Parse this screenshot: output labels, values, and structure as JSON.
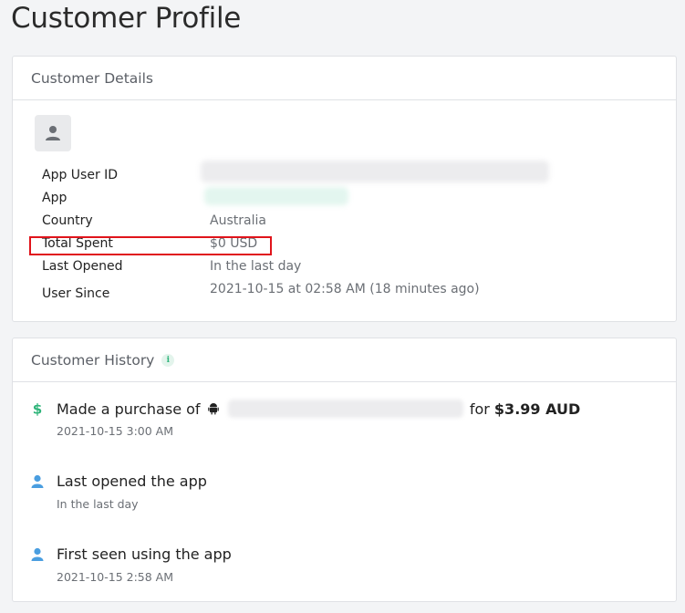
{
  "page": {
    "title": "Customer Profile"
  },
  "details": {
    "header": "Customer Details",
    "rows": [
      {
        "label": "App User ID",
        "value": ""
      },
      {
        "label": "App",
        "value": ""
      },
      {
        "label": "Country",
        "value": "Australia"
      },
      {
        "label": "Total Spent",
        "value": "$0 USD"
      },
      {
        "label": "Last Opened",
        "value": "In the last day"
      },
      {
        "label": "User Since",
        "value": "2021-10-15 at 02:58 AM (18 minutes ago)"
      }
    ]
  },
  "history": {
    "header": "Customer History",
    "info_icon": "i",
    "items": [
      {
        "icon": "dollar-icon",
        "prefix": "Made a purchase of",
        "platform_icon": "android-icon",
        "suffix": "for",
        "amount": "$3.99 AUD",
        "time": "2021-10-15 3:00 AM"
      },
      {
        "icon": "user-icon",
        "text": "Last opened the app",
        "time": "In the last day"
      },
      {
        "icon": "user-icon",
        "text": "First seen using the app",
        "time": "2021-10-15 2:58 AM"
      }
    ]
  },
  "colors": {
    "accent_green": "#2fb47a",
    "user_blue": "#4a9ee0",
    "highlight_red": "#e0141b"
  }
}
